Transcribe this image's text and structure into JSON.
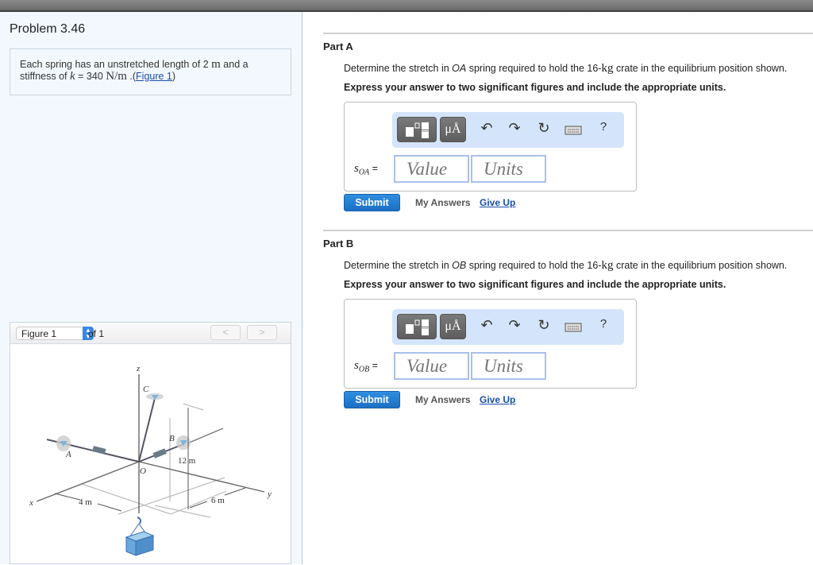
{
  "problem": {
    "title": "Problem 3.46",
    "statement_pre": "Each spring has an unstretched length of 2 ",
    "length_unit": "m",
    "statement_mid": " and a stiffness of ",
    "k_symbol": "k",
    "k_value": " = 340 ",
    "k_unit": "N/m",
    "statement_post": " .(",
    "figure_link": "Figure 1",
    "close_paren": ")"
  },
  "figure_viewer": {
    "selected": "Figure 1",
    "of_label": "of 1",
    "prev": "<",
    "next": ">",
    "labels": {
      "z": "z",
      "C": "C",
      "B": "B",
      "A": "A",
      "O": "O",
      "x": "x",
      "y": "y",
      "height": "12 m",
      "dist_x": "4 m",
      "dist_y": "6 m"
    }
  },
  "parts": [
    {
      "title": "Part A",
      "question_pre": "Determine the stretch in ",
      "spring": "OA",
      "question_mid": " spring required to hold the 16-",
      "mass_unit": "kg",
      "question_post": " crate in the equilibrium position shown.",
      "instruction": "Express your answer to two significant figures and include the appropriate units.",
      "var": "s",
      "var_sub": "OA",
      "equals": " =",
      "value_placeholder": "Value",
      "units_placeholder": "Units",
      "submit": "Submit",
      "my_answers": "My Answers",
      "give_up": "Give Up"
    },
    {
      "title": "Part B",
      "question_pre": "Determine the stretch in ",
      "spring": "OB",
      "question_mid": " spring required to hold the 16-",
      "mass_unit": "kg",
      "question_post": " crate in the equilibrium position shown.",
      "instruction": "Express your answer to two significant figures and include the appropriate units.",
      "var": "s",
      "var_sub": "OB",
      "equals": " =",
      "value_placeholder": "Value",
      "units_placeholder": "Units",
      "submit": "Submit",
      "my_answers": "My Answers",
      "give_up": "Give Up"
    }
  ],
  "toolbar": {
    "units_label": "μÅ",
    "help_label": "?",
    "icons": [
      "templates-icon",
      "units-icon",
      "undo-icon",
      "redo-icon",
      "reset-icon",
      "keyboard-icon",
      "help-icon"
    ]
  }
}
